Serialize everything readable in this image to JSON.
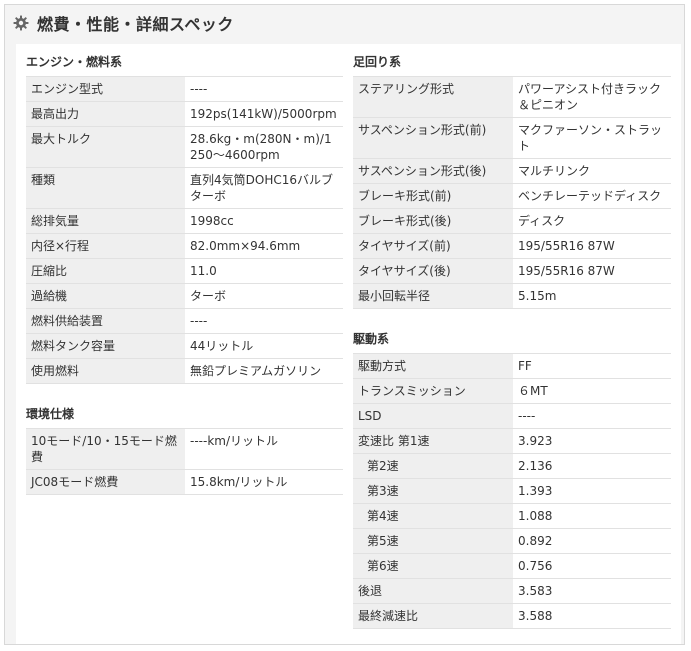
{
  "header": {
    "title": "燃費・性能・詳細スペック",
    "icon": "gear-icon"
  },
  "engine": {
    "title": "エンジン・燃料系",
    "rows": [
      {
        "k": "エンジン型式",
        "v": "----"
      },
      {
        "k": "最高出力",
        "v": "192ps(141kW)/5000rpm"
      },
      {
        "k": "最大トルク",
        "v": "28.6kg・m(280N・m)/1250～4600rpm"
      },
      {
        "k": "種類",
        "v": "直列4気筒DOHC16バルブターボ"
      },
      {
        "k": "総排気量",
        "v": "1998cc"
      },
      {
        "k": "内径×行程",
        "v": "82.0mm×94.6mm"
      },
      {
        "k": "圧縮比",
        "v": "11.0"
      },
      {
        "k": "過給機",
        "v": "ターボ"
      },
      {
        "k": "燃料供給装置",
        "v": "----"
      },
      {
        "k": "燃料タンク容量",
        "v": "44リットル"
      },
      {
        "k": "使用燃料",
        "v": "無鉛プレミアムガソリン"
      }
    ]
  },
  "environment": {
    "title": "環境仕様",
    "rows": [
      {
        "k": "10モード/10・15モード燃費",
        "v": "----km/リットル"
      },
      {
        "k": "JC08モード燃費",
        "v": "15.8km/リットル"
      }
    ]
  },
  "suspension": {
    "title": "足回り系",
    "rows": [
      {
        "k": "ステアリング形式",
        "v": "パワーアシスト付きラック＆ピニオン"
      },
      {
        "k": "サスペンション形式(前)",
        "v": "マクファーソン・ストラット"
      },
      {
        "k": "サスペンション形式(後)",
        "v": "マルチリンク"
      },
      {
        "k": "ブレーキ形式(前)",
        "v": "ベンチレーテッドディスク"
      },
      {
        "k": "ブレーキ形式(後)",
        "v": "ディスク"
      },
      {
        "k": "タイヤサイズ(前)",
        "v": "195/55R16 87W"
      },
      {
        "k": "タイヤサイズ(後)",
        "v": "195/55R16 87W"
      },
      {
        "k": "最小回転半径",
        "v": "5.15m"
      }
    ]
  },
  "drivetrain": {
    "title": "駆動系",
    "rows": [
      {
        "k": "駆動方式",
        "v": "FF",
        "sub": false
      },
      {
        "k": "トランスミッション",
        "v": "６MT",
        "sub": false
      },
      {
        "k": "LSD",
        "v": "----",
        "sub": false
      },
      {
        "k": "変速比 第1速",
        "v": "3.923",
        "sub": false
      },
      {
        "k": "第2速",
        "v": "2.136",
        "sub": true
      },
      {
        "k": "第3速",
        "v": "1.393",
        "sub": true
      },
      {
        "k": "第4速",
        "v": "1.088",
        "sub": true
      },
      {
        "k": "第5速",
        "v": "0.892",
        "sub": true
      },
      {
        "k": "第6速",
        "v": "0.756",
        "sub": true
      },
      {
        "k": "後退",
        "v": "3.583",
        "sub": false
      },
      {
        "k": "最終減速比",
        "v": "3.588",
        "sub": false
      }
    ]
  }
}
